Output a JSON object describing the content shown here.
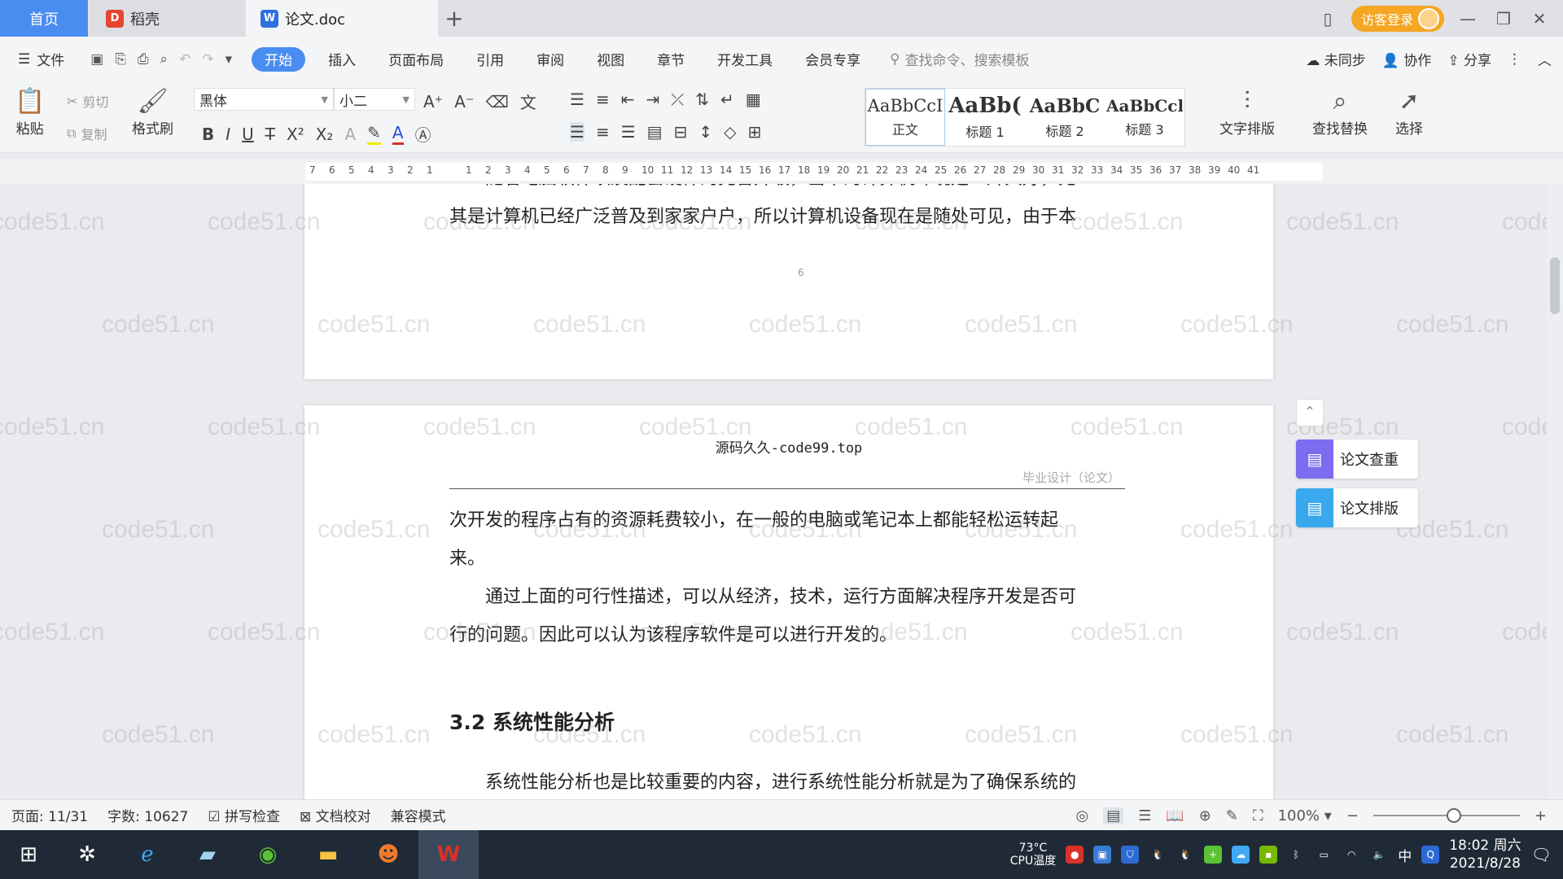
{
  "tabs": {
    "home": "首页",
    "daoke": "稻壳",
    "doc": "论文.doc",
    "add": "+"
  },
  "titlebar": {
    "login": "访客登录"
  },
  "menubar": {
    "file": "文件",
    "items": [
      "开始",
      "插入",
      "页面布局",
      "引用",
      "审阅",
      "视图",
      "章节",
      "开发工具",
      "会员专享"
    ],
    "search_placeholder": "查找命令、搜索模板",
    "unsynced": "未同步",
    "collab": "协作",
    "share": "分享"
  },
  "ribbon": {
    "paste": "粘贴",
    "cut": "剪切",
    "copy": "复制",
    "format_painter": "格式刷",
    "font_name": "黑体",
    "font_size": "小二",
    "styles": [
      {
        "sample": "AaBbCcI",
        "name": "正文"
      },
      {
        "sample": "AaBb(",
        "name": "标题 1"
      },
      {
        "sample": "AaBbC",
        "name": "标题 2"
      },
      {
        "sample": "AaBbCcl",
        "name": "标题 3"
      }
    ],
    "text_layout": "文字排版",
    "find_replace": "查找替换",
    "select": "选择"
  },
  "ruler": [
    "7",
    "6",
    "5",
    "4",
    "3",
    "2",
    "1",
    "",
    "1",
    "2",
    "3",
    "4",
    "5",
    "6",
    "7",
    "8",
    "9",
    "10",
    "11",
    "12",
    "13",
    "14",
    "15",
    "16",
    "17",
    "18",
    "19",
    "20",
    "21",
    "22",
    "23",
    "24",
    "25",
    "26",
    "27",
    "28",
    "29",
    "30",
    "31",
    "32",
    "33",
    "34",
    "35",
    "36",
    "37",
    "38",
    "39",
    "40",
    "41"
  ],
  "document": {
    "page1_line1": "随着电脑软件以及配套硬件的完善升级，当下的计算机环境是一片大好，尤",
    "page1_line2": "其是计算机已经广泛普及到家家户户，所以计算机设备现在是随处可见，由于本",
    "page1_mark": "6",
    "header_center": "源码久久-code99.top",
    "header_right": "毕业设计（论文）",
    "para1_line1": "次开发的程序占有的资源耗费较小，在一般的电脑或笔记本上都能轻松运转起",
    "para1_line2": "来。",
    "para2_line1": "通过上面的可行性描述，可以从经济，技术，运行方面解决程序开发是否可",
    "para2_line2": "行的问题。因此可以认为该程序软件是可以进行开发的。",
    "section_heading": "3.2  系统性能分析",
    "para3_line1": "系统性能分析也是比较重要的内容，进行系统性能分析就是为了确保系统的"
  },
  "watermark": "code51.cn",
  "side_panel": {
    "check": "论文查重",
    "format": "论文排版"
  },
  "statusbar": {
    "page": "页面: 11/31",
    "words": "字数: 10627",
    "spell": "拼写检查",
    "proof": "文档校对",
    "compat": "兼容模式",
    "zoom": "100%",
    "zoom_level": 100
  },
  "taskbar": {
    "temp": "73°C",
    "temp_label": "CPU温度",
    "ime": "中",
    "time": "18:02 周六",
    "date": "2021/8/28"
  },
  "colors": {
    "accent": "#4a8df1",
    "login": "#f5a623",
    "wps_red": "#d9312b",
    "taskbar": "#1f2a36"
  }
}
